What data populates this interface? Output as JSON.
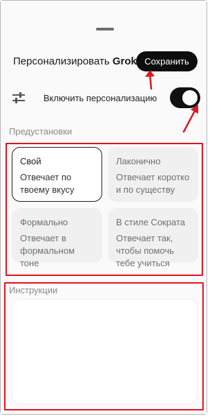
{
  "header": {
    "title": "Персонализировать",
    "brand": "Grok",
    "save_label": "Сохранить"
  },
  "toggle": {
    "label": "Включить персонализацию",
    "enabled": true
  },
  "presets": {
    "section_label": "Предустановки",
    "items": [
      {
        "title": "Свой",
        "description": "Отвечает по твоему вкусу",
        "selected": true
      },
      {
        "title": "Лаконично",
        "description": "Отвечает коротко и по существу",
        "selected": false
      },
      {
        "title": "Формально",
        "description": "Отвечает в формальном тоне",
        "selected": false
      },
      {
        "title": "В стиле Сократа",
        "description": "Отвечает так, чтобы помочь тебе учиться",
        "selected": false
      }
    ]
  },
  "instructions": {
    "section_label": "Инструкции",
    "value": ""
  },
  "colors": {
    "annotation_red": "#e0141d",
    "dark": "#0d0d0d"
  }
}
